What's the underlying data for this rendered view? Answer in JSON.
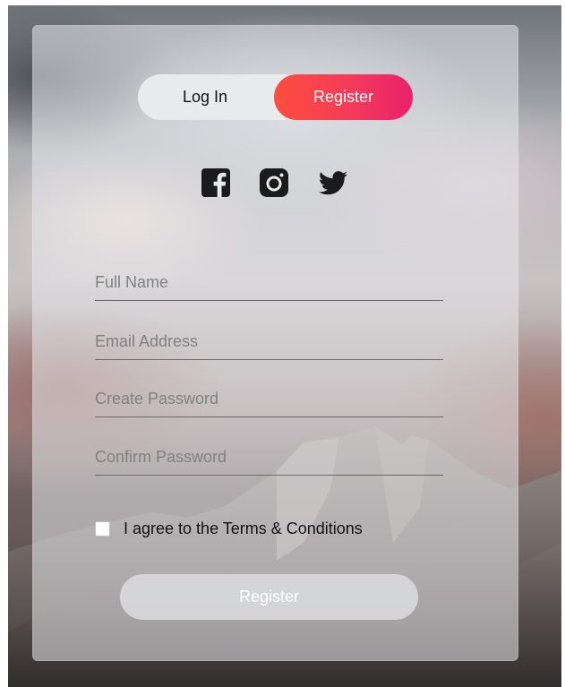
{
  "tabs": {
    "login_label": "Log In",
    "register_label": "Register",
    "active": "Register",
    "active_gradient": [
      "#ff4d3d",
      "#e8216c"
    ]
  },
  "social": {
    "icons": [
      "facebook-icon",
      "instagram-icon",
      "twitter-icon"
    ]
  },
  "form": {
    "full_name_placeholder": "Full Name",
    "email_placeholder": "Email Address",
    "password_placeholder": "Create Password",
    "confirm_password_placeholder": "Confirm Password",
    "terms_label": "I agree to the Terms & Conditions",
    "terms_checked": false,
    "submit_label": "Register"
  }
}
